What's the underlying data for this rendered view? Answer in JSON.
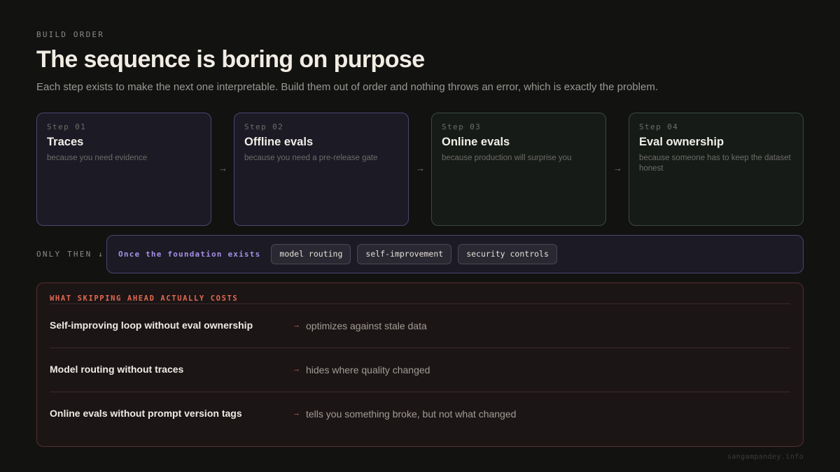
{
  "header": {
    "eyebrow": "BUILD ORDER",
    "title": "The sequence is boring on purpose",
    "subtitle": "Each step exists to make the next one interpretable. Build them out of order and nothing throws an error, which is exactly the problem."
  },
  "steps": [
    {
      "num": "Step 01",
      "title": "Traces",
      "desc": "because you need evidence"
    },
    {
      "num": "Step 02",
      "title": "Offline evals",
      "desc": "because you need a pre-release gate"
    },
    {
      "num": "Step 03",
      "title": "Online evals",
      "desc": "because production will surprise you"
    },
    {
      "num": "Step 04",
      "title": "Eval ownership",
      "desc": "because someone has to keep the dataset honest"
    }
  ],
  "arrow_glyph": "→",
  "only_then": {
    "label": "ONLY THEN ↓",
    "lead": "Once the foundation exists",
    "chips": [
      "model routing",
      "self-improvement",
      "security controls"
    ]
  },
  "costs": {
    "heading": "WHAT SKIPPING AHEAD ACTUALLY COSTS",
    "arrow_glyph": "→",
    "rows": [
      {
        "cause": "Self-improving loop without eval ownership",
        "effect": "optimizes against stale data"
      },
      {
        "cause": "Model routing without traces",
        "effect": "hides where quality changed"
      },
      {
        "cause": "Online evals without prompt version tags",
        "effect": "tells you something broke, but not what changed"
      }
    ]
  },
  "footer": "sangampandey.info",
  "colors": {
    "background": "#121211",
    "accent_purple": "#a691e6",
    "accent_red": "#e06a52",
    "step_blue_border": "#4c4772",
    "step_green_border": "#3b4a3e"
  }
}
